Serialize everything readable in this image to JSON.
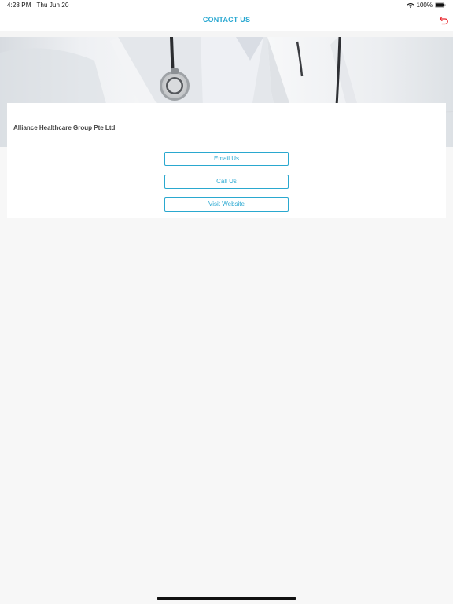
{
  "status_bar": {
    "time": "4:28 PM",
    "date": "Thu Jun 20",
    "battery": "100%",
    "icons": [
      "wifi-icon",
      "battery-icon"
    ]
  },
  "nav": {
    "title": "CONTACT US",
    "back_icon": "back-arrow-icon"
  },
  "hero": {
    "image": "doctor-stethoscope-photo"
  },
  "contact": {
    "company": "Alliance Healthcare Group Pte Ltd",
    "buttons": [
      {
        "label": "Email Us"
      },
      {
        "label": "Call Us"
      },
      {
        "label": "Visit Website"
      }
    ]
  },
  "colors": {
    "accent": "#29a8d1",
    "back_arrow": "#e8242b",
    "company_text": "#444444",
    "background": "#f7f7f7"
  }
}
